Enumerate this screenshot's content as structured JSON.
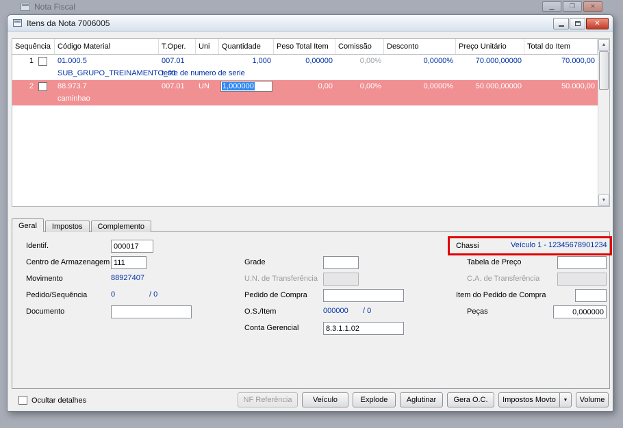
{
  "parent_window": {
    "title": "Nota Fiscal"
  },
  "dialog": {
    "title": "Itens da Nota 7006005"
  },
  "grid": {
    "columns": [
      "Sequência",
      "Código Material",
      "T.Oper.",
      "Uni",
      "Quantidade",
      "Peso Total Item",
      "Comissão",
      "Desconto",
      "Preço Unitário",
      "Total do Item"
    ],
    "rows": [
      {
        "seq": "1",
        "codigo": "01.000.5",
        "codigo_desc": "SUB_GRUPO_TREINAMENTO_01",
        "toper": "007.01",
        "toper_desc": "teste de numero de serie",
        "uni": "",
        "quantidade": "1,000",
        "peso": "0,00000",
        "comissao": "0,00%",
        "desconto": "0,0000%",
        "preco_unitario": "70.000,00000",
        "total_item": "70.000,00"
      },
      {
        "seq": "2",
        "codigo": "88.973.7",
        "codigo_desc": "caminhao",
        "toper": "007.01",
        "toper_desc": "",
        "uni": "UN",
        "quantidade": "1,000000",
        "peso": "0,00",
        "comissao": "0,00%",
        "desconto": "0,0000%",
        "preco_unitario": "50.000,00000",
        "total_item": "50.000,00"
      }
    ]
  },
  "tabs": {
    "geral": "Geral",
    "impostos": "Impostos",
    "complemento": "Complemento"
  },
  "form": {
    "identif": {
      "label": "Identif.",
      "value": "000017"
    },
    "centro_armazenagem": {
      "label": "Centro de Armazenagem",
      "value": "111"
    },
    "movimento": {
      "label": "Movimento",
      "value": "88927407"
    },
    "pedido_sequencia": {
      "label": "Pedido/Sequência",
      "value": "0",
      "value2": "/ 0"
    },
    "documento": {
      "label": "Documento",
      "value": ""
    },
    "grade": {
      "label": "Grade",
      "value": ""
    },
    "un_transferencia": {
      "label": "U.N. de Transferência",
      "value": ""
    },
    "pedido_compra": {
      "label": "Pedido de Compra",
      "value": ""
    },
    "os_item": {
      "label": "O.S./Item",
      "value": "000000",
      "value2": "/ 0"
    },
    "conta_gerencial": {
      "label": "Conta Gerencial",
      "value": "8.3.1.1.02"
    },
    "chassi": {
      "label": "Chassi",
      "value": "Veículo 1 - 12345678901234"
    },
    "tabela_preco": {
      "label": "Tabela de Preço",
      "value": ""
    },
    "ca_transferencia": {
      "label": "C.A. de Transferência",
      "value": ""
    },
    "item_pedido_compra": {
      "label": "Item do Pedido de Compra",
      "value": ""
    },
    "pecas": {
      "label": "Peças",
      "value": "0,000000"
    }
  },
  "footer": {
    "ocultar_detalhes": "Ocultar detalhes",
    "nf_referencia": "NF Referência",
    "veiculo": "Veículo",
    "explode": "Explode",
    "aglutinar": "Aglutinar",
    "gera_oc": "Gera O.C.",
    "impostos_movto": "Impostos Movto",
    "volume": "Volume"
  },
  "colors": {
    "value_blue": "#0031a8",
    "selected_row_pink": "#f19093",
    "selection_blue": "#2f86f5",
    "highlight_red": "#e10000"
  }
}
